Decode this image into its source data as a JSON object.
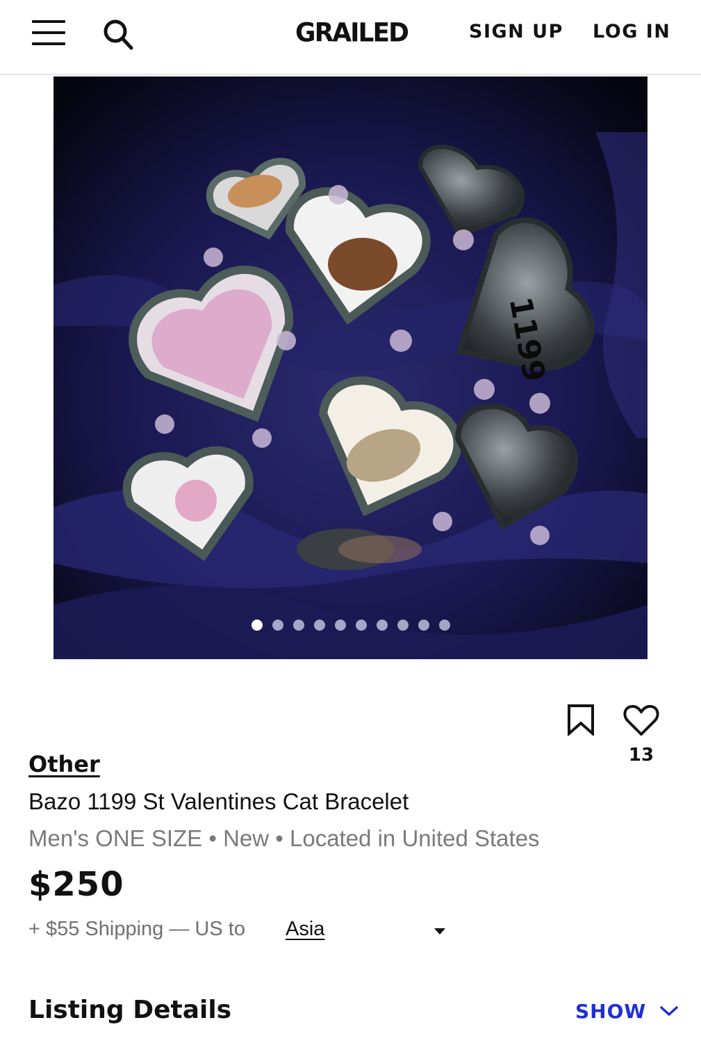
{
  "header": {
    "logo_text": "GRAILED",
    "signup_label": "SIGN UP",
    "login_label": "LOG IN",
    "icons": [
      "menu-icon",
      "search-icon"
    ]
  },
  "gallery": {
    "image_count": 10,
    "active_index": 0
  },
  "actions": {
    "favorites_count": "13",
    "icons": [
      "bookmark-icon",
      "heart-icon"
    ]
  },
  "listing": {
    "brand": "Other",
    "title": "Bazo 1199 St Valentines Cat Bracelet",
    "meta": "Men's ONE SIZE • New • Located in United States",
    "price": "$250",
    "shipping": "+ $55 Shipping — US to",
    "shipping_region": "Asia"
  },
  "details": {
    "heading": "Listing Details",
    "toggle_label": "SHOW"
  },
  "colors": {
    "accent": "#1f2fd1",
    "text": "#111111",
    "muted": "#7a7a7a"
  }
}
